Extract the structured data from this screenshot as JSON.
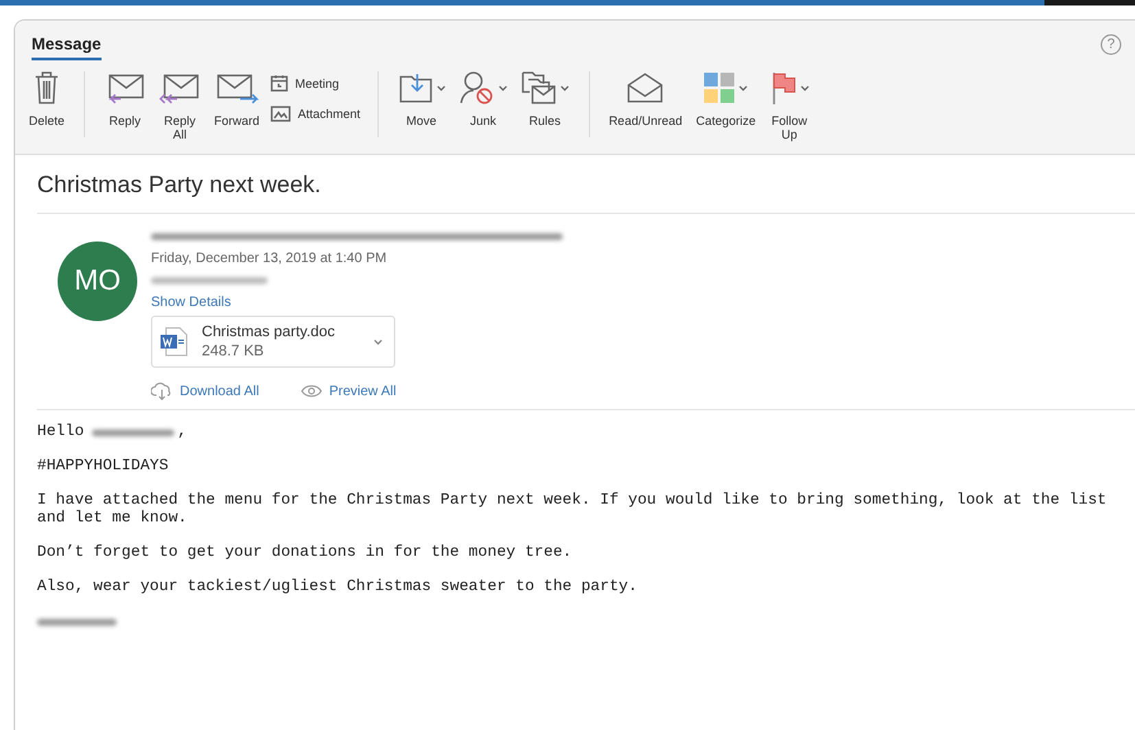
{
  "tabs": [
    {
      "label": "Message",
      "selected": true
    }
  ],
  "help": "?",
  "toolbar": [
    {
      "items": [
        {
          "label": "Delete",
          "kind": "large",
          "menu": false
        }
      ]
    },
    {
      "items": [
        {
          "label": "Reply",
          "kind": "large",
          "menu": false
        },
        {
          "label": "Reply\nAll",
          "kind": "large",
          "menu": false
        },
        {
          "label": "Forward",
          "kind": "large",
          "menu": false
        },
        {
          "label": "Meeting",
          "kind": "small",
          "menu": false
        },
        {
          "label": "Attachment",
          "kind": "small",
          "menu": false
        }
      ]
    },
    {
      "items": [
        {
          "label": "Move",
          "kind": "large",
          "menu": true
        },
        {
          "label": "Junk",
          "kind": "large",
          "menu": true
        },
        {
          "label": "Rules",
          "kind": "large",
          "menu": true
        }
      ]
    },
    {
      "items": [
        {
          "label": "Read/Unread",
          "kind": "large",
          "menu": false
        },
        {
          "label": "Categorize",
          "kind": "large",
          "menu": true
        },
        {
          "label": "Follow\nUp",
          "kind": "large",
          "menu": true
        }
      ]
    }
  ],
  "subject": "Christmas Party next week.",
  "message": {
    "avatar": "MO",
    "date": "Friday, December 13, 2019 at 1:40 PM",
    "show_details": "Show Details",
    "attachment": {
      "name": "Christmas party.doc",
      "size": "248.7 KB"
    },
    "actions": [
      "Download All",
      "Preview All"
    ]
  },
  "body": {
    "greeting_start": "Hello",
    "greeting_end": ",",
    "paragraphs": [
      "#HAPPYHOLIDAYS",
      "I have attached the menu for the Christmas Party next week. If you would like to bring something, look at the list and let me know.",
      "Don’t forget to get your donations in for the money tree.",
      "Also, wear your tackiest/ugliest Christmas sweater to the party."
    ]
  }
}
